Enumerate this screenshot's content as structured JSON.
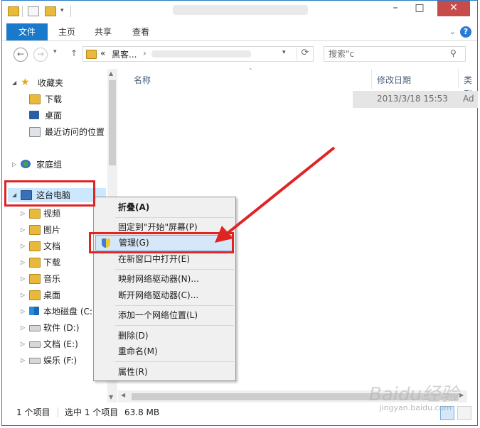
{
  "tabs": {
    "file": "文件",
    "home": "主页",
    "share": "共享",
    "view": "查看"
  },
  "address": {
    "chevrons": "«",
    "crumb": "黑客...",
    "sep": "›"
  },
  "search": {
    "placeholder": "搜索\"c"
  },
  "nav": {
    "favorites": "收藏夹",
    "downloads": "下载",
    "desktop": "桌面",
    "recent": "最近访问的位置",
    "homegroup": "家庭组",
    "this_pc": "这台电脑",
    "videos": "视频",
    "pictures": "图片",
    "documents": "文档",
    "downloads2": "下载",
    "music": "音乐",
    "desktop2": "桌面",
    "local_c": "本地磁盘 (C:)",
    "drive_d": "软件 (D:)",
    "drive_e": "文档 (E:)",
    "drive_f": "娱乐 (F:)"
  },
  "columns": {
    "name": "名称",
    "date": "修改日期",
    "type": "类型"
  },
  "rows": [
    {
      "date": "2013/3/18 15:53",
      "type": "Ad"
    }
  ],
  "status": {
    "count": "1 个项目",
    "selected": "选中 1 个项目",
    "size": "63.8 MB"
  },
  "context_menu": {
    "collapse": "折叠(A)",
    "pin_start": "固定到\"开始\"屏幕(P)",
    "manage": "管理(G)",
    "open_new_window": "在新窗口中打开(E)",
    "map_drive": "映射网络驱动器(N)...",
    "disconnect_drive": "断开网络驱动器(C)...",
    "add_network_location": "添加一个网络位置(L)",
    "delete": "删除(D)",
    "rename": "重命名(M)",
    "properties": "属性(R)"
  },
  "watermark": {
    "brand": "Baidu经验",
    "url": "jingyan.baidu.com"
  },
  "colors": {
    "accent": "#1979ca",
    "highlight_red": "#e02424",
    "menu_hover": "#d5e7f8"
  }
}
